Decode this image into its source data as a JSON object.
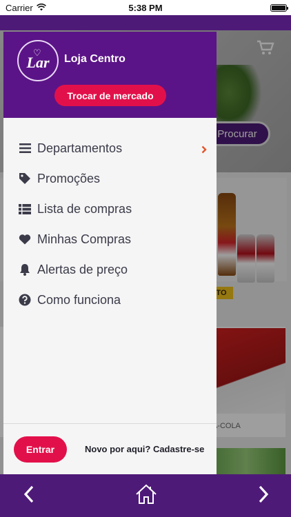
{
  "status_bar": {
    "carrier": "Carrier",
    "time": "5:38 PM"
  },
  "drawer": {
    "store_name": "Loja Centro",
    "logo_text": "Lar",
    "change_market_label": "Trocar de mercado",
    "menu": [
      {
        "label": "Departamentos",
        "icon": "menu-lines-icon",
        "has_chevron": true
      },
      {
        "label": "Promoções",
        "icon": "tag-icon"
      },
      {
        "label": "Lista de compras",
        "icon": "list-icon"
      },
      {
        "label": "Minhas Compras",
        "icon": "heart-icon"
      },
      {
        "label": "Alertas de preço",
        "icon": "bell-icon"
      },
      {
        "label": "Como funciona",
        "icon": "question-circle-icon"
      }
    ],
    "login_label": "Entrar",
    "signup_label": "Novo por aqui? Cadastre-se"
  },
  "background": {
    "search_button_label": "Procurar",
    "tag_text": "NTO",
    "product_text": "CA-COLA"
  },
  "colors": {
    "brand_purple": "#5b1487",
    "nav_purple": "#4e1a78",
    "accent_red": "#e2104a",
    "chevron_orange": "#e0552b"
  }
}
